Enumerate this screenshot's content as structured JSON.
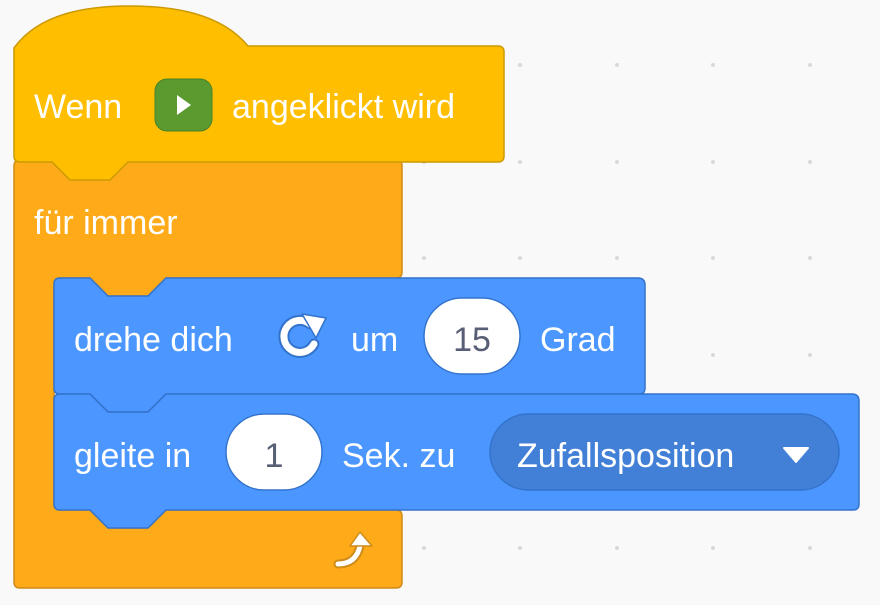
{
  "colors": {
    "background": "#f9f9f9",
    "events_block": "#ffbf00",
    "events_border": "#cc9900",
    "control_block": "#ffab19",
    "control_border": "#cf8b17",
    "motion_block": "#4c97ff",
    "motion_border": "#3373cc",
    "dropdown_fill": "#4280d7",
    "flag_green": "#5b9a2f"
  },
  "blocks": {
    "hat": {
      "text_before": "Wenn",
      "icon": "green-flag-icon",
      "text_after": "angeklickt wird"
    },
    "forever": {
      "label": "für immer",
      "end_icon": "loop-arrow-icon"
    },
    "turn": {
      "text_before": "drehe dich",
      "icon": "rotate-right-icon",
      "text_mid": "um",
      "degrees_value": "15",
      "text_after": "Grad"
    },
    "glide": {
      "text_before": "gleite in",
      "seconds_value": "1",
      "text_mid": "Sek. zu",
      "target_value": "Zufallsposition",
      "dropdown_icon": "dropdown-arrow-icon"
    }
  }
}
